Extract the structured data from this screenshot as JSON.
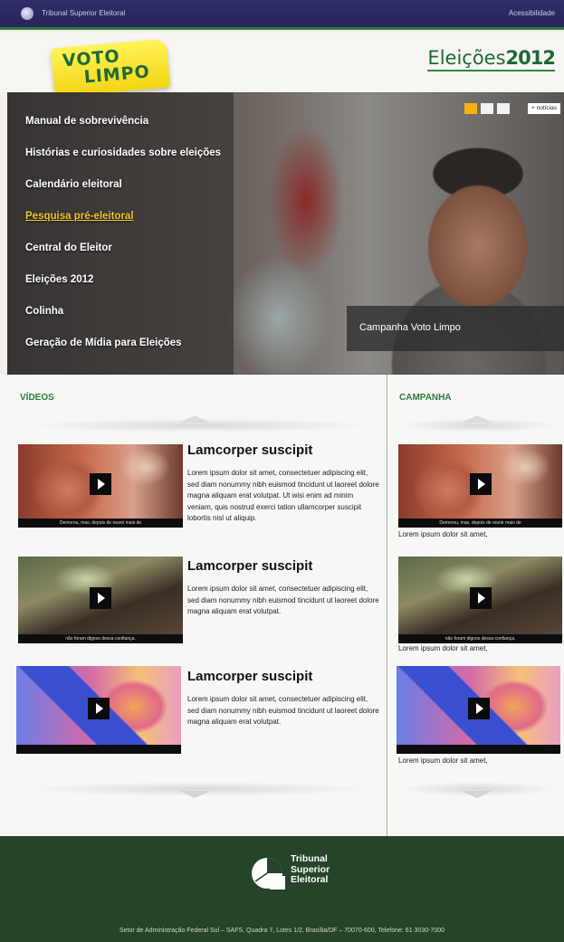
{
  "topbar": {
    "org": "Tribunal Superior Eleitoral",
    "accessibility": "Acessibilidade"
  },
  "header": {
    "badge_line1": "VOTO",
    "badge_line2": "LIMPO",
    "eleicoes_word": "Eleições",
    "eleicoes_year": "2012"
  },
  "hero": {
    "menu": [
      {
        "label": "Manual de sobrevivência",
        "active": false
      },
      {
        "label": "Histórias e curiosidades sobre eleições",
        "active": false
      },
      {
        "label": "Calendário eleitoral",
        "active": false
      },
      {
        "label": "Pesquisa  pré-eleitoral",
        "active": true
      },
      {
        "label": "Central do Eleitor",
        "active": false
      },
      {
        "label": "Eleições 2012",
        "active": false
      },
      {
        "label": "Colinha",
        "active": false
      },
      {
        "label": "Geração de Mídia para Eleições",
        "active": false
      }
    ],
    "more_news": "+ notícias",
    "caption": "Campanha Voto Limpo",
    "accent": "#f3b413"
  },
  "videos": {
    "title": "VÍDEOS",
    "items": [
      {
        "title": "Lamcorper suscipit",
        "subtitle": "Demorou, mas, depois de reunir mais de",
        "description": "Lorem ipsum dolor sit amet, consectetuer adipiscing elit, sed diam nonummy nibh euismod tincidunt ut laoreet dolore magna aliquam erat volutpat. Ut wisi enim ad minim veniam, quis nostrud exerci tation ullamcorper suscipit lobortis nisl ut aliquip."
      },
      {
        "title": "Lamcorper suscipit",
        "subtitle": "não foram dignos dessa confiança.",
        "description": "Lorem ipsum dolor sit amet, consectetuer adipiscing elit, sed diam nonummy nibh euismod tincidunt ut laoreet dolore magna aliquam erat volutpat."
      },
      {
        "title": "Lamcorper suscipit",
        "subtitle": "",
        "description": "Lorem ipsum dolor sit amet, consectetuer adipiscing elit, sed diam nonummy nibh euismod tincidunt ut laoreet dolore magna aliquam erat volutpat."
      }
    ]
  },
  "campaign": {
    "title": "CAMPANHA",
    "items": [
      {
        "subtitle": "Demorou, mas, depois de reunir mais de",
        "caption": "Lorem ipsum dolor sit amet,"
      },
      {
        "subtitle": "não foram dignos dessa confiança.",
        "caption": "Lorem ipsum dolor sit amet,"
      },
      {
        "subtitle": "",
        "caption": "Lorem ipsum dolor sit amet,"
      }
    ]
  },
  "footer": {
    "org_line1": "Tribunal",
    "org_line2": "Superior",
    "org_line3": "Eleitoral",
    "address": "Setor de Administração Federal Sul – SAFS, Quadra 7, Lotes 1/2, Brasília/DF – 70070-600, Telefone: 61 3030-7000"
  },
  "colors": {
    "green": "#2e7d3a",
    "navy": "#2e2e6c",
    "footer": "#24452a"
  }
}
